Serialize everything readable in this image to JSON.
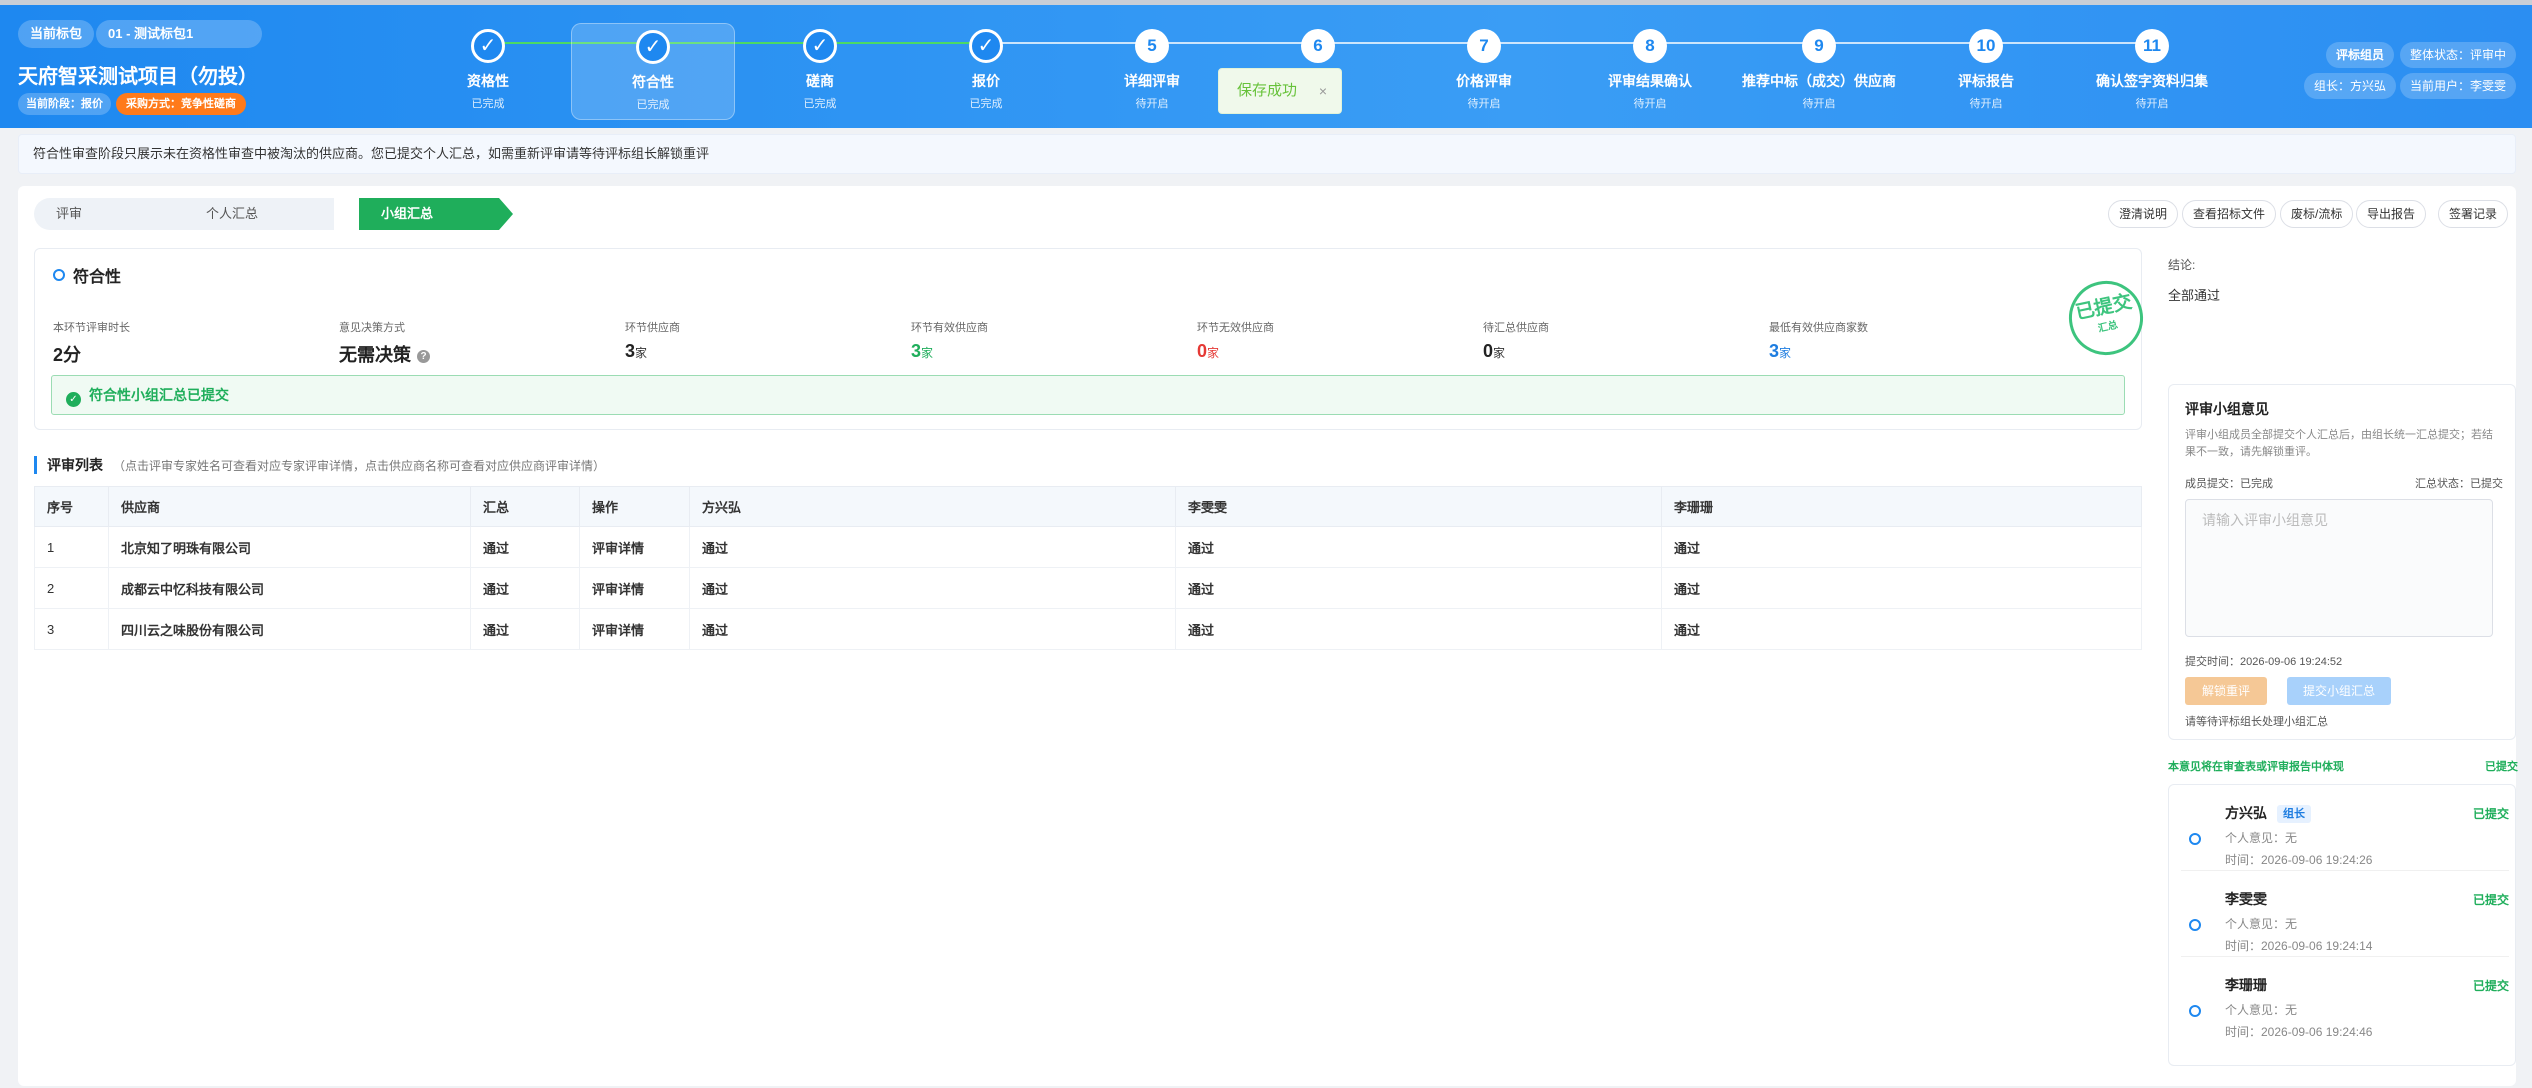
{
  "header": {
    "tag_current_package": "当前标包",
    "package_name": "01 - 测试标包1",
    "project_title": "天府智采测试项目（勿投）",
    "phase_label": "当前阶段：报价",
    "purchase_method": "采购方式：竞争性磋商",
    "role": "评标组员",
    "overall_status": "整体状态：评审中",
    "leader": "组长：方兴弘",
    "current_user": "当前用户：李雯雯"
  },
  "steps": [
    {
      "num": "✓",
      "label": "资格性",
      "status": "已完成",
      "done": true
    },
    {
      "num": "✓",
      "label": "符合性",
      "status": "已完成",
      "done": true,
      "active": true
    },
    {
      "num": "✓",
      "label": "磋商",
      "status": "已完成",
      "done": true
    },
    {
      "num": "✓",
      "label": "报价",
      "status": "已完成",
      "done": true
    },
    {
      "num": "5",
      "label": "详细评审",
      "status": "待开启",
      "done": false
    },
    {
      "num": "6",
      "label": "",
      "status": "",
      "done": false
    },
    {
      "num": "7",
      "label": "价格评审",
      "status": "待开启",
      "done": false
    },
    {
      "num": "8",
      "label": "评审结果确认",
      "status": "待开启",
      "done": false
    },
    {
      "num": "9",
      "label": "推荐中标（成交）供应商",
      "status": "待开启",
      "done": false
    },
    {
      "num": "10",
      "label": "评标报告",
      "status": "待开启",
      "done": false
    },
    {
      "num": "11",
      "label": "确认签字资料归集",
      "status": "待开启",
      "done": false
    }
  ],
  "toast": {
    "text": "保存成功",
    "close": "×"
  },
  "notice": "符合性审查阶段只展示未在资格性审查中被淘汰的供应商。您已提交个人汇总，如需重新评审请等待评标组长解锁重评",
  "tabs": [
    "评审",
    "个人汇总",
    "小组汇总"
  ],
  "toolbar": [
    "澄清说明",
    "查看招标文件",
    "废标/流标",
    "导出报告",
    "签署记录"
  ],
  "section": {
    "title": "符合性",
    "stats": [
      {
        "label": "本环节评审时长",
        "value": "2分",
        "unit": ""
      },
      {
        "label": "意见决策方式",
        "value": "无需决策",
        "unit": ""
      },
      {
        "label": "环节供应商",
        "value": "3",
        "unit": "家"
      },
      {
        "label": "环节有效供应商",
        "value": "3",
        "unit": "家"
      },
      {
        "label": "环节无效供应商",
        "value": "0",
        "unit": "家"
      },
      {
        "label": "待汇总供应商",
        "value": "0",
        "unit": "家"
      },
      {
        "label": "最低有效供应商家数",
        "value": "3",
        "unit": "家"
      }
    ],
    "stamp_main": "已提交",
    "stamp_sub": "汇总",
    "submitted_text": "符合性小组汇总已提交",
    "check": "✓",
    "qmark": "?"
  },
  "list": {
    "title": "评审列表",
    "hint": "（点击评审专家姓名可查看对应专家评审详情，点击供应商名称可查看对应供应商评审详情）",
    "headers": [
      "序号",
      "供应商",
      "汇总",
      "操作",
      "方兴弘",
      "李雯雯",
      "李珊珊"
    ],
    "rows": [
      {
        "no": "1",
        "supplier": "北京知了明珠有限公司",
        "summary": "通过",
        "action": "评审详情",
        "e1": "通过",
        "e2": "通过",
        "e3": "通过"
      },
      {
        "no": "2",
        "supplier": "成都云中忆科技有限公司",
        "summary": "通过",
        "action": "评审详情",
        "e1": "通过",
        "e2": "通过",
        "e3": "通过"
      },
      {
        "no": "3",
        "supplier": "四川云之味股份有限公司",
        "summary": "通过",
        "action": "评审详情",
        "e1": "通过",
        "e2": "通过",
        "e3": "通过"
      }
    ]
  },
  "side": {
    "conclusion_label": "结论:",
    "conclusion_value": "全部通过",
    "panel_title": "评审小组意见",
    "panel_desc": "评审小组成员全部提交个人汇总后，由组长统一汇总提交；若结果不一致，请先解锁重评。",
    "member_submit": "成员提交：已完成",
    "summary_status": "汇总状态：已提交",
    "textarea_placeholder": "请输入评审小组意见",
    "submit_time": "提交时间：2026-09-06 19:24:52",
    "unlock_btn": "解锁重评",
    "submit_btn": "提交小组汇总",
    "wait_text": "请等待评标组长处理小组汇总",
    "report_note": "本意见将在审查表或评审报告中体现",
    "report_status": "已提交",
    "members": [
      {
        "name": "方兴弘",
        "badge": "组长",
        "status": "已提交",
        "opinion": "个人意见：无",
        "time": "时间：2026-09-06 19:24:26"
      },
      {
        "name": "李雯雯",
        "badge": "",
        "status": "已提交",
        "opinion": "个人意见：无",
        "time": "时间：2026-09-06 19:24:14"
      },
      {
        "name": "李珊珊",
        "badge": "",
        "status": "已提交",
        "opinion": "个人意见：无",
        "time": "时间：2026-09-06 19:24:46"
      }
    ]
  },
  "colors": {
    "primary": "#1e88f0",
    "success": "#1fae5b",
    "danger": "#e53935",
    "orange": "#ff7a1a"
  }
}
